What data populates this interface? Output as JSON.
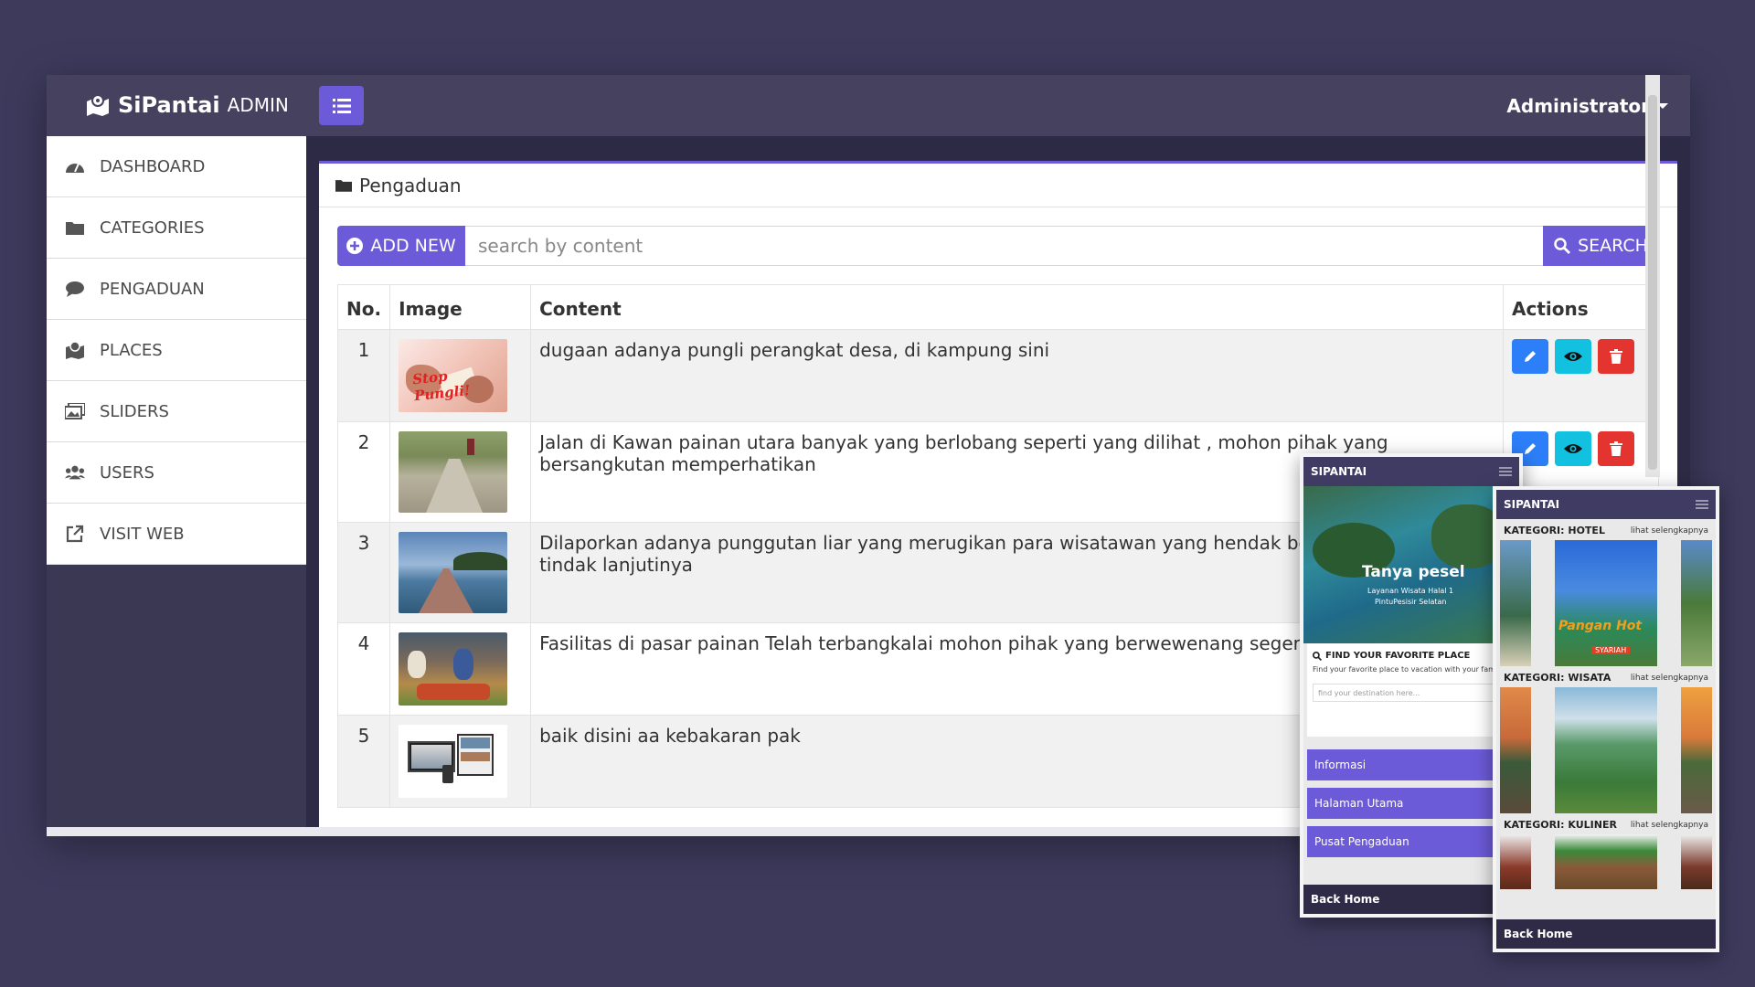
{
  "brand": {
    "name": "SiPantai",
    "suffix": "ADMIN"
  },
  "header": {
    "user": "Administrator"
  },
  "sidebar": {
    "items": [
      {
        "label": "DASHBOARD",
        "icon": "dashboard-icon"
      },
      {
        "label": "CATEGORIES",
        "icon": "folder-icon"
      },
      {
        "label": "PENGADUAN",
        "icon": "comment-icon"
      },
      {
        "label": "PLACES",
        "icon": "map-icon"
      },
      {
        "label": "SLIDERS",
        "icon": "images-icon"
      },
      {
        "label": "USERS",
        "icon": "users-icon"
      },
      {
        "label": "VISIT WEB",
        "icon": "external-link-icon"
      }
    ]
  },
  "main": {
    "title": "Pengaduan",
    "add_label": "ADD NEW",
    "search_placeholder": "search by content",
    "search_label": "SEARCH",
    "columns": [
      "No.",
      "Image",
      "Content",
      "Actions"
    ],
    "rows": [
      {
        "no": "1",
        "content": "dugaan adanya pungli perangkat desa, di kampung sini",
        "thumb": "Stop Pungli!"
      },
      {
        "no": "2",
        "content": "Jalan di Kawan painan utara banyak yang berlobang seperti yang dilihat , mohon pihak yang bersangkutan memperhatikan",
        "thumb": ""
      },
      {
        "no": "3",
        "content": "Dilaporkan adanya punggutan liar yang merugikan para wisatawan yang hendak berku carocok mohon tindak lanjutinya",
        "thumb": ""
      },
      {
        "no": "4",
        "content": "Fasilitas di pasar painan Telah terbangkalai mohon pihak yang berwewenang segera m",
        "thumb": ""
      },
      {
        "no": "5",
        "content": "baik disini aa kebakaran pak",
        "thumb": ""
      }
    ]
  },
  "phone_left": {
    "brand": "SIPANTAI",
    "hero_title": "Tanya pesel",
    "hero_sub1": "Layanan Wisata Halal 1",
    "hero_sub2": "PintuPesisir Selatan",
    "find_title": "FIND YOUR FAVORITE PLACE",
    "find_text": "Find your favorite place to vacation with your family!",
    "find_placeholder": "find your destination here...",
    "menu": [
      "Informasi",
      "Halaman Utama",
      "Pusat Pengaduan"
    ],
    "back": "Back Home"
  },
  "phone_right": {
    "brand": "SIPANTAI",
    "categories": [
      {
        "title": "KATEGORI: HOTEL",
        "more": "lihat selengkapnya",
        "sign": "Pangan Hot",
        "sign2": "SYARIAH"
      },
      {
        "title": "KATEGORI: WISATA",
        "more": "lihat selengkapnya"
      },
      {
        "title": "KATEGORI: KULINER",
        "more": "lihat selengkapnya"
      }
    ],
    "back": "Back Home"
  },
  "colors": {
    "accent": "#6c5bd8",
    "edit": "#2d7ff9",
    "view": "#12c0e0",
    "delete": "#e3342f",
    "background": "#3d3a5c"
  }
}
